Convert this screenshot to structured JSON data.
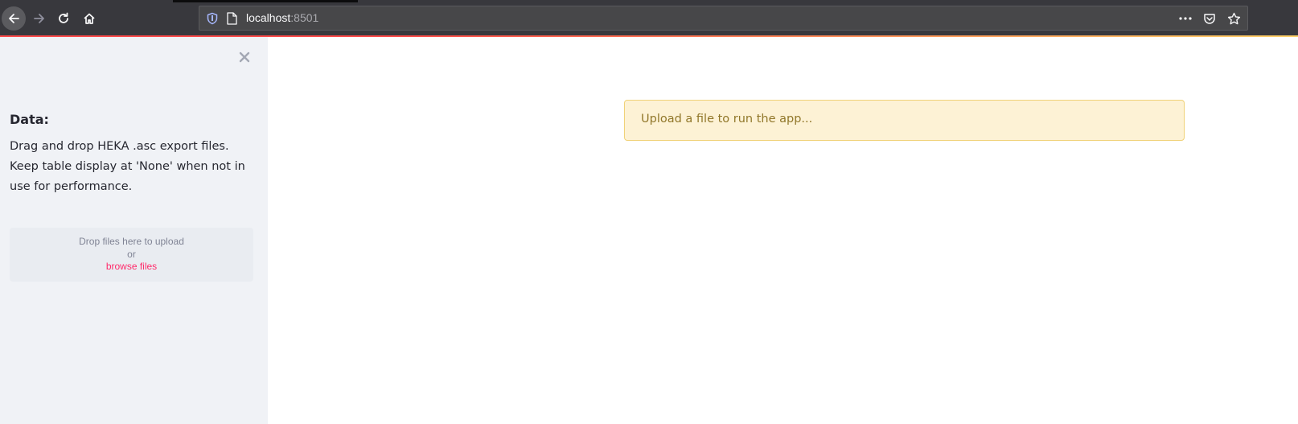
{
  "browser": {
    "url_host": "localhost",
    "url_port": ":8501",
    "icons": {
      "back": "back-arrow-icon",
      "forward": "forward-arrow-icon",
      "reload": "reload-icon",
      "home": "home-icon",
      "shield": "tracking-protection-shield-icon",
      "page": "page-info-icon",
      "more": "more-actions-icon",
      "pocket": "pocket-icon",
      "bookmark": "bookmark-star-icon"
    }
  },
  "sidebar": {
    "title": "Data:",
    "description_line1": "Drag and drop HEKA .asc export files.",
    "description_line2": "Keep table display at 'None' when not in use for performance.",
    "dropzone": {
      "instruction": "Drop files here to upload",
      "or": "or",
      "browse_label": "browse files"
    }
  },
  "main": {
    "alert_text": "Upload a file to run the app..."
  },
  "colors": {
    "accent": "#ff4b4b",
    "browse_link": "#ff2b6b",
    "alert_bg": "#fdf2d5",
    "alert_text": "#91772a"
  }
}
